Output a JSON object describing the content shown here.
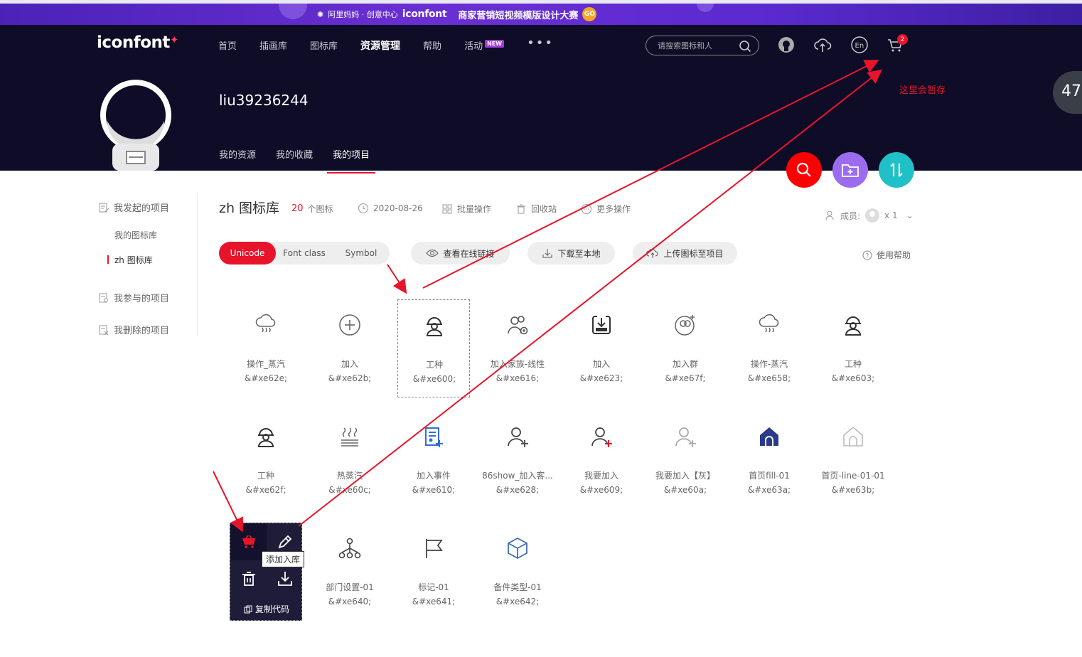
{
  "banner": {
    "partner": "阿里妈妈 · 创意中心",
    "brand": "iconfont",
    "title": "商家营销短视频模版设计大赛",
    "go": "GO"
  },
  "header": {
    "logo": "iconfont",
    "nav": [
      "首页",
      "插画库",
      "图标库",
      "资源管理",
      "帮助",
      "活动"
    ],
    "nav_new": "NEW",
    "more": "•••",
    "search_placeholder": "请搜索图标和人",
    "cart_count": "2",
    "username": "liu39236244",
    "tabs": [
      "我的资源",
      "我的收藏",
      "我的项目"
    ]
  },
  "overlay": {
    "gauge": "47",
    "annotation": "这里会暂存"
  },
  "sidebar": {
    "initiated": "我发起的项目",
    "sub1": "我的图标库",
    "sub2": "zh 图标库",
    "joined": "我参与的项目",
    "deleted": "我删除的项目"
  },
  "project": {
    "title": "zh 图标库",
    "count": "20",
    "count_label": "个图标",
    "date": "2020-08-26",
    "batch": "批量操作",
    "recycle": "回收站",
    "more": "更多操作",
    "members_label": "成员:",
    "members_count": "x 1"
  },
  "toolbar": {
    "modes": [
      "Unicode",
      "Font class",
      "Symbol"
    ],
    "view_link": "查看在线链接",
    "download": "下载至本地",
    "upload": "上传图标至项目",
    "help": "使用帮助"
  },
  "icons": [
    {
      "name": "操作_蒸汽",
      "code": "&#xe62e;",
      "icon": "steam-cloud-icon"
    },
    {
      "name": "加入",
      "code": "&#xe62b;",
      "icon": "plus-circle-icon"
    },
    {
      "name": "工种",
      "code": "&#xe600;",
      "icon": "worker-icon"
    },
    {
      "name": "加入家族-线性",
      "code": "&#xe616;",
      "icon": "join-family-icon"
    },
    {
      "name": "加入",
      "code": "&#xe623;",
      "icon": "join-box-icon"
    },
    {
      "name": "加入群",
      "code": "&#xe67f;",
      "icon": "join-group-icon"
    },
    {
      "name": "操作-蒸汽",
      "code": "&#xe658;",
      "icon": "steam-cloud-icon"
    },
    {
      "name": "工种",
      "code": "&#xe603;",
      "icon": "worker-icon"
    },
    {
      "name": "工种",
      "code": "&#xe62f;",
      "icon": "worker-icon"
    },
    {
      "name": "热蒸汽",
      "code": "&#xe60c;",
      "icon": "hot-steam-icon"
    },
    {
      "name": "加入事件",
      "code": "&#xe610;",
      "icon": "join-event-icon"
    },
    {
      "name": "86show_加入客...",
      "code": "&#xe628;",
      "icon": "add-user-icon"
    },
    {
      "name": "我要加入",
      "code": "&#xe609;",
      "icon": "add-user-red-icon"
    },
    {
      "name": "我要加入【灰】",
      "code": "&#xe60a;",
      "icon": "add-user-gray-icon"
    },
    {
      "name": "首页fill-01",
      "code": "&#xe63a;",
      "icon": "home-fill-icon"
    },
    {
      "name": "首页-line-01-01",
      "code": "&#xe63b;",
      "icon": "home-line-icon"
    },
    {
      "name": "部门设置-01",
      "code": "&#xe640;",
      "icon": "org-chart-icon"
    },
    {
      "name": "标记-01",
      "code": "&#xe641;",
      "icon": "flag-icon"
    },
    {
      "name": "备件类型-01",
      "code": "&#xe642;",
      "icon": "cube-icon"
    }
  ],
  "hover": {
    "tooltip": "添加入库",
    "copy": "复制代码"
  },
  "colors": {
    "brand_red": "#e8142b",
    "header_bg": "#0e0c26",
    "banner_purple": "#5b2ad0",
    "search_btn": "#ff0000",
    "folder_btn": "#9b6cf0",
    "sort_btn": "#1fc0c7"
  }
}
